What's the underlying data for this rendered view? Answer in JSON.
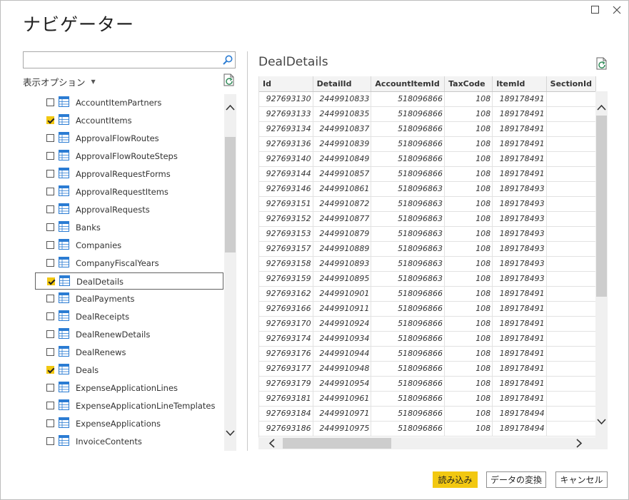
{
  "dialog": {
    "title": "ナビゲーター"
  },
  "left": {
    "search": {
      "value": "",
      "placeholder": ""
    },
    "options_label": "表示オプション",
    "items": [
      {
        "label": "AccountItemPartners",
        "checked": false
      },
      {
        "label": "AccountItems",
        "checked": true
      },
      {
        "label": "ApprovalFlowRoutes",
        "checked": false
      },
      {
        "label": "ApprovalFlowRouteSteps",
        "checked": false
      },
      {
        "label": "ApprovalRequestForms",
        "checked": false
      },
      {
        "label": "ApprovalRequestItems",
        "checked": false
      },
      {
        "label": "ApprovalRequests",
        "checked": false
      },
      {
        "label": "Banks",
        "checked": false
      },
      {
        "label": "Companies",
        "checked": false
      },
      {
        "label": "CompanyFiscalYears",
        "checked": false
      },
      {
        "label": "DealDetails",
        "checked": true,
        "selected": true
      },
      {
        "label": "DealPayments",
        "checked": false
      },
      {
        "label": "DealReceipts",
        "checked": false
      },
      {
        "label": "DealRenewDetails",
        "checked": false
      },
      {
        "label": "DealRenews",
        "checked": false
      },
      {
        "label": "Deals",
        "checked": true
      },
      {
        "label": "ExpenseApplicationLines",
        "checked": false
      },
      {
        "label": "ExpenseApplicationLineTemplates",
        "checked": false
      },
      {
        "label": "ExpenseApplications",
        "checked": false
      },
      {
        "label": "InvoiceContents",
        "checked": false
      }
    ]
  },
  "preview": {
    "title": "DealDetails",
    "columns": [
      "Id",
      "DetailId",
      "AccountItemId",
      "TaxCode",
      "ItemId",
      "SectionId"
    ],
    "rows": [
      [
        "927693130",
        "2449910833",
        "518096866",
        "108",
        "189178491",
        ""
      ],
      [
        "927693133",
        "2449910835",
        "518096866",
        "108",
        "189178491",
        ""
      ],
      [
        "927693134",
        "2449910837",
        "518096866",
        "108",
        "189178491",
        ""
      ],
      [
        "927693136",
        "2449910839",
        "518096866",
        "108",
        "189178491",
        ""
      ],
      [
        "927693140",
        "2449910849",
        "518096866",
        "108",
        "189178491",
        ""
      ],
      [
        "927693144",
        "2449910857",
        "518096866",
        "108",
        "189178491",
        ""
      ],
      [
        "927693146",
        "2449910861",
        "518096863",
        "108",
        "189178493",
        ""
      ],
      [
        "927693151",
        "2449910872",
        "518096863",
        "108",
        "189178493",
        ""
      ],
      [
        "927693152",
        "2449910877",
        "518096863",
        "108",
        "189178493",
        ""
      ],
      [
        "927693153",
        "2449910879",
        "518096863",
        "108",
        "189178493",
        ""
      ],
      [
        "927693157",
        "2449910889",
        "518096863",
        "108",
        "189178493",
        ""
      ],
      [
        "927693158",
        "2449910893",
        "518096863",
        "108",
        "189178493",
        ""
      ],
      [
        "927693159",
        "2449910895",
        "518096863",
        "108",
        "189178493",
        ""
      ],
      [
        "927693162",
        "2449910901",
        "518096866",
        "108",
        "189178491",
        ""
      ],
      [
        "927693166",
        "2449910911",
        "518096866",
        "108",
        "189178491",
        ""
      ],
      [
        "927693170",
        "2449910924",
        "518096866",
        "108",
        "189178491",
        ""
      ],
      [
        "927693174",
        "2449910934",
        "518096866",
        "108",
        "189178491",
        ""
      ],
      [
        "927693176",
        "2449910944",
        "518096866",
        "108",
        "189178491",
        ""
      ],
      [
        "927693177",
        "2449910948",
        "518096866",
        "108",
        "189178491",
        ""
      ],
      [
        "927693179",
        "2449910954",
        "518096866",
        "108",
        "189178491",
        ""
      ],
      [
        "927693181",
        "2449910961",
        "518096866",
        "108",
        "189178491",
        ""
      ],
      [
        "927693184",
        "2449910971",
        "518096866",
        "108",
        "189178494",
        ""
      ],
      [
        "927693186",
        "2449910975",
        "518096866",
        "108",
        "189178494",
        ""
      ]
    ]
  },
  "footer": {
    "load_label": "読み込み",
    "transform_label": "データの変換",
    "cancel_label": "キャンセル"
  },
  "colors": {
    "accent": "#f2c811",
    "table_icon": "#2b7cd3"
  }
}
